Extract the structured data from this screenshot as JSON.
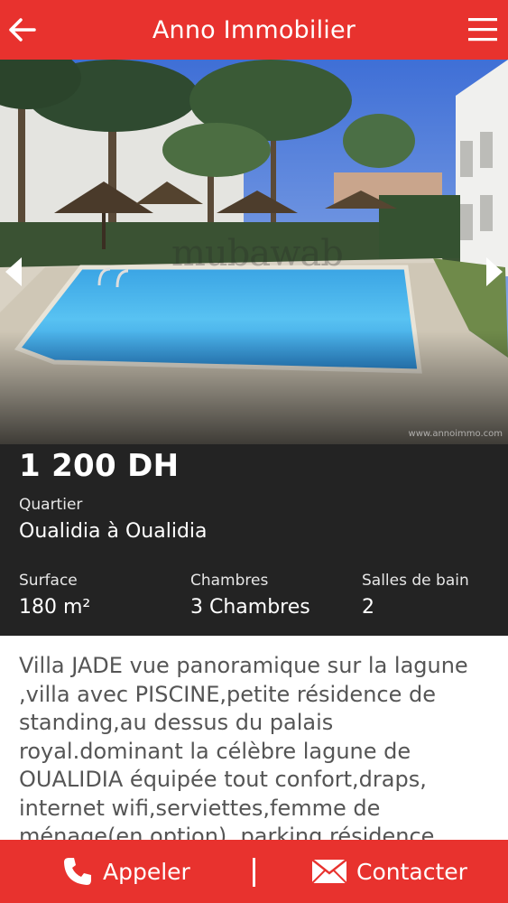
{
  "header": {
    "title": "Anno Immobilier",
    "back_icon": "arrow-left-icon",
    "menu_icon": "hamburger-menu-icon",
    "color": "#e8322e"
  },
  "gallery": {
    "watermark": "mubawab",
    "credit": "www.annoimmo.com",
    "prev_icon": "chevron-left-icon",
    "next_icon": "chevron-right-icon"
  },
  "listing": {
    "price": "1 200 DH",
    "quartier_label": "Quartier",
    "quartier_value": "Oualidia à Oualidia",
    "surface_label": "Surface",
    "surface_value": "180 m²",
    "chambres_label": "Chambres",
    "chambres_value": "3 Chambres",
    "bains_label": "Salles de bain",
    "bains_value": "2",
    "description": "Villa JADE vue panoramique sur la lagune ,villa avec PISCINE,petite résidence de standing,au dessus du palais royal.dominant la célèbre lagune de OUALIDIA équipée tout confort,draps, internet wifi,serviettes,femme de ménage(en option), parking résidence"
  },
  "actions": {
    "call_label": "Appeler",
    "call_icon": "phone-icon",
    "contact_label": "Contacter",
    "contact_icon": "envelope-icon"
  }
}
